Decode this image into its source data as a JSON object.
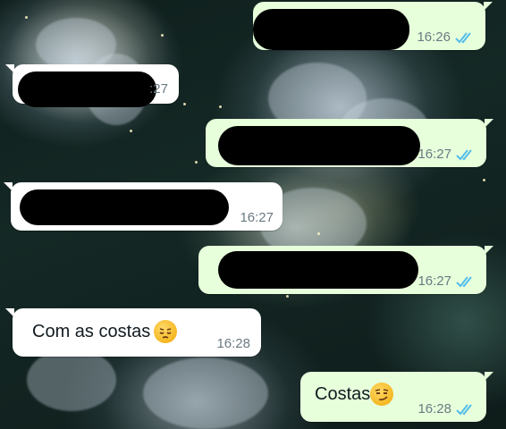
{
  "chat": {
    "messages": [
      {
        "direction": "outgoing",
        "time": "16:26",
        "status": "read",
        "redacted": true
      },
      {
        "direction": "incoming",
        "time": "16:27",
        "redacted": true
      },
      {
        "direction": "outgoing",
        "time": "16:27",
        "status": "read",
        "redacted": true
      },
      {
        "direction": "incoming",
        "time": "16:27",
        "redacted": true
      },
      {
        "direction": "outgoing",
        "time": "16:27",
        "status": "read",
        "redacted": true
      },
      {
        "direction": "incoming",
        "time": "16:28",
        "text": "Com as costas",
        "emoji": "pensive-face"
      },
      {
        "direction": "outgoing",
        "time": "16:28",
        "status": "read",
        "text": "Costas",
        "emoji": "smirking-face"
      }
    ],
    "partial_time_msg2": ":27"
  },
  "colors": {
    "outgoing_bubble": "#e7ffdb",
    "incoming_bubble": "#ffffff",
    "read_ticks": "#53bdeb",
    "time_text": "#6b7a82"
  },
  "icons": {
    "read_receipt": "double-check-icon"
  }
}
